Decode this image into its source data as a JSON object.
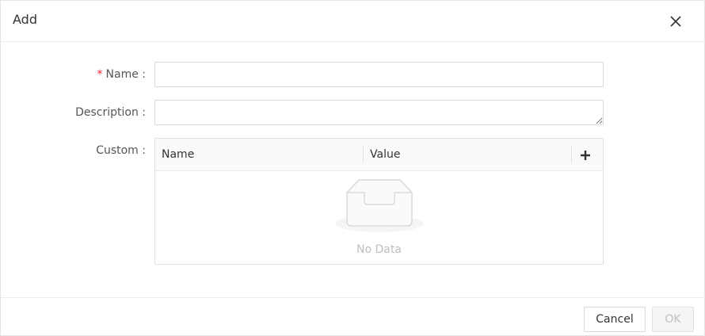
{
  "dialog": {
    "title": "Add",
    "close_icon": "close-icon"
  },
  "form": {
    "name": {
      "required_mark": "*",
      "label": "Name :",
      "value": ""
    },
    "description": {
      "label": "Description :",
      "value": ""
    },
    "custom": {
      "label": "Custom :",
      "columns": [
        "Name",
        "Value"
      ],
      "add_icon": "plus-icon",
      "empty_icon": "empty-inbox-icon",
      "empty_text": "No Data"
    }
  },
  "footer": {
    "cancel_label": "Cancel",
    "ok_label": "OK"
  },
  "colors": {
    "required": "#f5222d",
    "border": "#d9d9d9",
    "disabled_text": "#bfbfbf"
  }
}
